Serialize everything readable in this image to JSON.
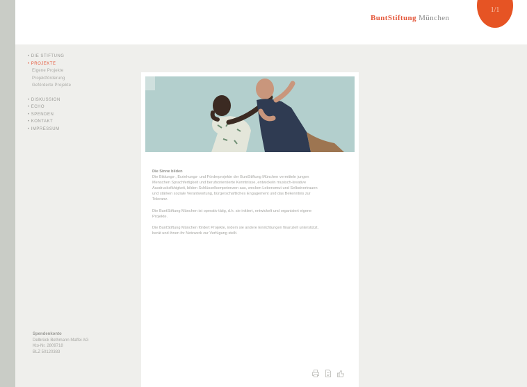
{
  "brand": {
    "part1": "BuntStiftung",
    "part2": " München",
    "badge": "1/1"
  },
  "nav": {
    "items": [
      "• DIE STIFTUNG",
      "• PROJEKTE"
    ],
    "subitems": [
      "Eigene Projekte",
      "Projektförderung",
      "Geförderte Projekte"
    ],
    "items2": [
      "• DISKUSSION",
      "• ECHO",
      "• SPENDEN",
      "• KONTAKT",
      "• IMPRESSUM"
    ]
  },
  "bank": {
    "title": "Spendenkonto",
    "line1": "Delbrück Bethmann Maffei AG",
    "line2": "Kto-Nr. 2809718",
    "line3": "BLZ 50120383"
  },
  "content": {
    "title": "Die Sinne bilden",
    "p1": "Die Bildungs-, Erziehungs- und Förderprojekte der BuntStiftung München vermitteln jungen Menschen Sprachfertigkeit und berufsorientierte Kenntnisse, entwickeln musisch-kreative Ausdrucksfähigkeit, bilden Schlüsselkompetenzen aus, wecken Lebensmut und Selbstvertrauen und stärken soziale Verantwortung, bürgerschaftliches Engagement und das Bekenntnis zur Toleranz.",
    "p2": "Die BuntStiftung München ist operativ tätig, d.h. sie initiiert, entwickelt und organisiert eigene Projekte.",
    "p3": "Die BuntStiftung München fördert Projekte, indem sie andere Einrichtungen finanziell unterstützt, berät und ihnen ihr Netzwerk zur Verfügung stellt."
  },
  "icons": [
    "print-icon",
    "document-icon",
    "recommend-icon"
  ],
  "colors": {
    "accent": "#e4573a",
    "badge": "#e65424",
    "frame": "#c9ccc6",
    "bg": "#efefec"
  }
}
